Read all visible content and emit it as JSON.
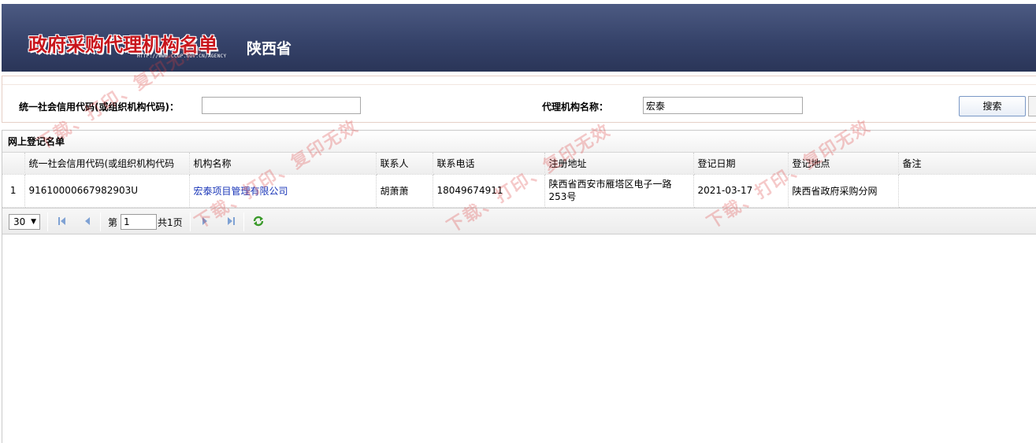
{
  "banner": {
    "logo_text": "政府采购代理机构名单",
    "url_text": "HTTP://WWW.CCGP.GOV.CN/AGENCY",
    "province": "陕西省"
  },
  "search": {
    "credit_code_label": "统一社会信用代码(或组织机构代码)：",
    "credit_code_value": "",
    "agency_name_label": "代理机构名称：",
    "agency_name_value": "宏泰",
    "search_button": "搜索"
  },
  "grid": {
    "title": "网上登记名单",
    "columns": [
      "统一社会信用代码(或组织机构代码",
      "机构名称",
      "联系人",
      "联系电话",
      "注册地址",
      "登记日期",
      "登记地点",
      "备注"
    ],
    "rows": [
      {
        "row_number": "1",
        "credit_code": "91610000667982903U",
        "name": "宏泰项目管理有限公司",
        "contact": "胡萧萧",
        "phone": "18049674911",
        "address": "陕西省西安市雁塔区电子一路253号",
        "reg_date": "2021-03-17",
        "reg_place": "陕西省政府采购分网",
        "note": ""
      }
    ]
  },
  "pager": {
    "page_size": "30",
    "page_prefix": "第",
    "current_page": "1",
    "total_pages": "共1页"
  },
  "watermark": {
    "text": "下载、打印、复印无效"
  },
  "colors": {
    "banner": "#36436a",
    "logo": "#c8151b",
    "link": "#1a36b8",
    "watermark": "#dc3c3c"
  }
}
